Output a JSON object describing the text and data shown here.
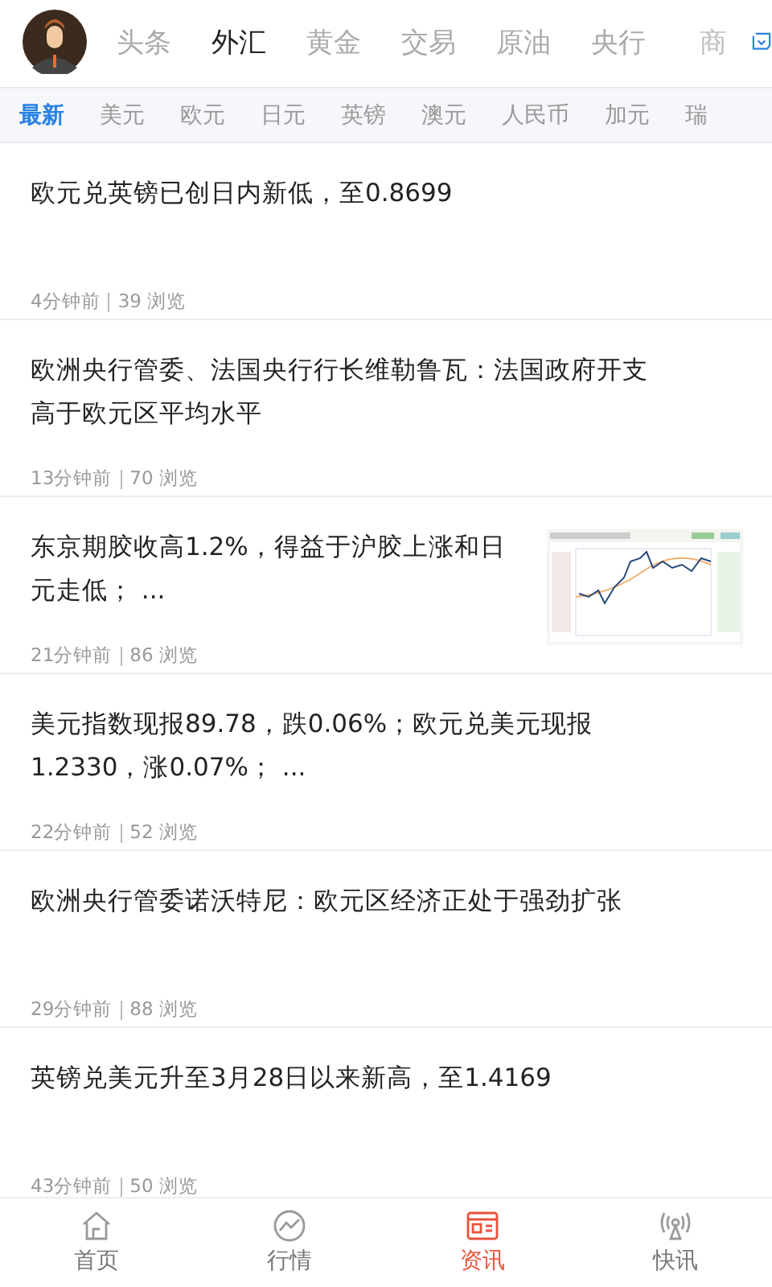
{
  "top_tabs": [
    {
      "label": "头条",
      "selected": false
    },
    {
      "label": "外汇",
      "selected": true
    },
    {
      "label": "黄金",
      "selected": false
    },
    {
      "label": "交易",
      "selected": false
    },
    {
      "label": "原油",
      "selected": false
    },
    {
      "label": "央行",
      "selected": false
    },
    {
      "label": "商",
      "selected": false
    }
  ],
  "sub_tabs": [
    {
      "label": "最新",
      "selected": true
    },
    {
      "label": "美元",
      "selected": false
    },
    {
      "label": "欧元",
      "selected": false
    },
    {
      "label": "日元",
      "selected": false
    },
    {
      "label": "英镑",
      "selected": false
    },
    {
      "label": "澳元",
      "selected": false
    },
    {
      "label": "人民币",
      "selected": false
    },
    {
      "label": "加元",
      "selected": false
    },
    {
      "label": "瑞",
      "selected": false
    }
  ],
  "articles": [
    {
      "title": "欧元兑英镑已创日内新低，至0.8699",
      "time": "4分钟前",
      "views": "39 浏览"
    },
    {
      "title": "欧洲央行管委、法国央行行长维勒鲁瓦：法国政府开支高于欧元区平均水平",
      "time": "13分钟前",
      "views": "70 浏览"
    },
    {
      "title": "东京期胶收高1.2%，得益于沪胶上涨和日元走低； ...",
      "time": "21分钟前",
      "views": "86 浏览"
    },
    {
      "title": "美元指数现报89.78，跌0.06%；欧元兑美元现报1.2330，涨0.07%； ...",
      "time": "22分钟前",
      "views": "52 浏览"
    },
    {
      "title": "欧洲央行管委诺沃特尼：欧元区经济正处于强劲扩张",
      "time": "29分钟前",
      "views": "88 浏览"
    },
    {
      "title": "英镑兑美元升至3月28日以来新高，至1.4169",
      "time": "43分钟前",
      "views": "50 浏览"
    }
  ],
  "bottom_nav": [
    {
      "label": "首页",
      "selected": false
    },
    {
      "label": "行情",
      "selected": false
    },
    {
      "label": "资讯",
      "selected": true
    },
    {
      "label": "快讯",
      "selected": false
    }
  ]
}
